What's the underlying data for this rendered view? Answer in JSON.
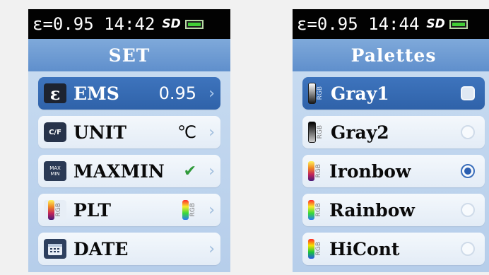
{
  "left": {
    "status": "ε=0.95 14:42",
    "sd_label": "SD",
    "title": "SET",
    "items": [
      {
        "label": "EMS",
        "value": "0.95",
        "icon": "epsilon-icon",
        "selected": true
      },
      {
        "label": "UNIT",
        "value": "℃",
        "icon": "unit-cf-icon"
      },
      {
        "label": "MAXMIN",
        "value": "✔",
        "icon": "maxmin-icon"
      },
      {
        "label": "PLT",
        "value": "RGB",
        "icon": "palette-icon"
      },
      {
        "label": "DATE",
        "value": "",
        "icon": "calendar-icon"
      }
    ]
  },
  "right": {
    "status": "ε=0.95 14:44",
    "sd_label": "SD",
    "title": "Palettes",
    "items": [
      {
        "label": "Gray1",
        "rgb": "RGB",
        "selected": true
      },
      {
        "label": "Gray2",
        "rgb": "RGB"
      },
      {
        "label": "Ironbow",
        "rgb": "RGB",
        "checked": true
      },
      {
        "label": "Rainbow",
        "rgb": "RGB"
      },
      {
        "label": "HiCont",
        "rgb": "RGB"
      }
    ]
  },
  "icons": {
    "ems_glyph": "ε",
    "unit_glyph": "C/F",
    "maxmin_top": "MAX",
    "maxmin_bottom": "MIN",
    "chevron": "›"
  },
  "colors": {
    "title_bar": "#6a97d1",
    "selected_item": "#3568b2",
    "check": "#2f9a3a",
    "radio_on": "#2a5fb1"
  }
}
